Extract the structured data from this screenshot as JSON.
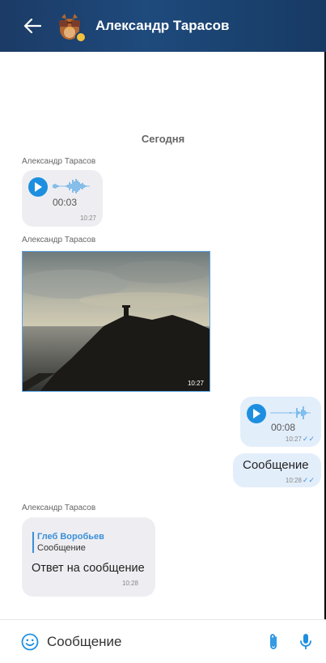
{
  "header": {
    "title": "Александр Тарасов",
    "colors": {
      "bar": "#1e4a7c",
      "status": "#f4c13d"
    }
  },
  "chat": {
    "date_separator": "Сегодня",
    "messages": [
      {
        "type": "voice",
        "direction": "in",
        "sender": "Александр Тарасов",
        "duration": "00:03",
        "time": "10:27"
      },
      {
        "type": "photo",
        "direction": "in",
        "sender": "Александр Тарасов",
        "time": "10:27"
      },
      {
        "type": "voice",
        "direction": "out",
        "duration": "00:08",
        "time": "10:27",
        "read": true
      },
      {
        "type": "text",
        "direction": "out",
        "text": "Сообщение",
        "time": "10:28",
        "read": true
      },
      {
        "type": "reply",
        "direction": "in",
        "sender": "Александр Тарасов",
        "reply_to_name": "Глеб Воробьев",
        "reply_to_text": "Сообщение",
        "text": "Ответ на сообщение",
        "time": "10:28"
      }
    ]
  },
  "composer": {
    "placeholder": "Сообщение",
    "icons": [
      "emoji-icon",
      "paperclip-icon",
      "microphone-icon"
    ],
    "accent": "#1e8fe0"
  }
}
